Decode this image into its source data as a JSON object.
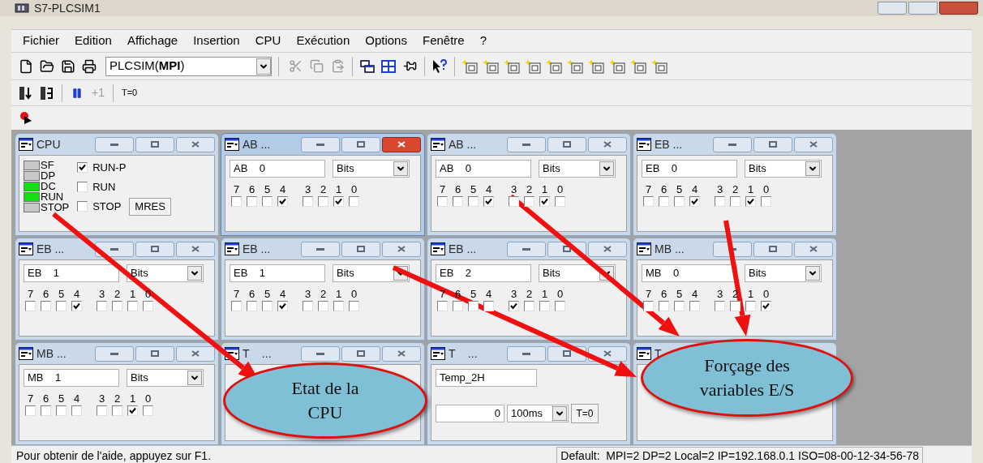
{
  "window": {
    "title": "S7-PLCSIM1"
  },
  "menu": [
    "Fichier",
    "Edition",
    "Affichage",
    "Insertion",
    "CPU",
    "Exécution",
    "Options",
    "Fenêtre",
    "?"
  ],
  "toolbar": {
    "plc_select": "PLCSIM(**MPI**)",
    "step_button": "+1",
    "reset_button": "T=0"
  },
  "panels": [
    {
      "kind": "cpu",
      "title": "CPU",
      "active": false,
      "leds": [
        {
          "label": "SF",
          "on": false
        },
        {
          "label": "DP",
          "on": false
        },
        {
          "label": "DC",
          "on": true
        },
        {
          "label": "RUN",
          "on": true
        },
        {
          "label": "STOP",
          "on": false
        }
      ],
      "modes": [
        {
          "label": "RUN-P",
          "checked": true
        },
        {
          "label": "RUN",
          "checked": false
        },
        {
          "label": "STOP",
          "checked": false
        }
      ],
      "mres_button": "MRES"
    },
    {
      "kind": "byte",
      "title": "AB ...",
      "active": true,
      "address": "AB    0",
      "format": "Bits",
      "bits": [
        {
          "label": "7",
          "checked": false
        },
        {
          "label": "6",
          "checked": false
        },
        {
          "label": "5",
          "checked": false
        },
        {
          "label": "4",
          "checked": true
        },
        {
          "label": "3",
          "checked": false
        },
        {
          "label": "2",
          "checked": false
        },
        {
          "label": "1",
          "checked": true
        },
        {
          "label": "0",
          "checked": false
        }
      ]
    },
    {
      "kind": "byte",
      "title": "AB ...",
      "active": false,
      "address": "AB    0",
      "format": "Bits",
      "bits": [
        {
          "label": "7",
          "checked": false
        },
        {
          "label": "6",
          "checked": false
        },
        {
          "label": "5",
          "checked": false
        },
        {
          "label": "4",
          "checked": true
        },
        {
          "label": "3",
          "checked": false
        },
        {
          "label": "2",
          "checked": false
        },
        {
          "label": "1",
          "checked": true
        },
        {
          "label": "0",
          "checked": false
        }
      ]
    },
    {
      "kind": "byte",
      "title": "EB ...",
      "active": false,
      "address": "EB    0",
      "format": "Bits",
      "bits": [
        {
          "label": "7",
          "checked": false
        },
        {
          "label": "6",
          "checked": false
        },
        {
          "label": "5",
          "checked": false
        },
        {
          "label": "4",
          "checked": true
        },
        {
          "label": "3",
          "checked": false
        },
        {
          "label": "2",
          "checked": false
        },
        {
          "label": "1",
          "checked": true
        },
        {
          "label": "0",
          "checked": false
        }
      ]
    },
    {
      "kind": "byte",
      "title": "EB ...",
      "active": false,
      "address": "EB    1",
      "format": "Bits",
      "bits": [
        {
          "label": "7",
          "checked": false
        },
        {
          "label": "6",
          "checked": false
        },
        {
          "label": "5",
          "checked": false
        },
        {
          "label": "4",
          "checked": true
        },
        {
          "label": "3",
          "checked": false
        },
        {
          "label": "2",
          "checked": false
        },
        {
          "label": "1",
          "checked": false
        },
        {
          "label": "0",
          "checked": false
        }
      ]
    },
    {
      "kind": "byte",
      "title": "EB ...",
      "active": false,
      "address": "EB    1",
      "format": "Bits",
      "bits": [
        {
          "label": "7",
          "checked": false
        },
        {
          "label": "6",
          "checked": false
        },
        {
          "label": "5",
          "checked": false
        },
        {
          "label": "4",
          "checked": true
        },
        {
          "label": "3",
          "checked": false
        },
        {
          "label": "2",
          "checked": false
        },
        {
          "label": "1",
          "checked": false
        },
        {
          "label": "0",
          "checked": false
        }
      ]
    },
    {
      "kind": "byte",
      "title": "EB ...",
      "active": false,
      "address": "EB    2",
      "format": "Bits",
      "bits": [
        {
          "label": "7",
          "checked": false
        },
        {
          "label": "6",
          "checked": false
        },
        {
          "label": "5",
          "checked": false
        },
        {
          "label": "4",
          "checked": false
        },
        {
          "label": "3",
          "checked": true
        },
        {
          "label": "2",
          "checked": false
        },
        {
          "label": "1",
          "checked": false
        },
        {
          "label": "0",
          "checked": false
        }
      ]
    },
    {
      "kind": "byte",
      "title": "MB ...",
      "active": false,
      "address": "MB    0",
      "format": "Bits",
      "bits": [
        {
          "label": "7",
          "checked": false
        },
        {
          "label": "6",
          "checked": false
        },
        {
          "label": "5",
          "checked": false
        },
        {
          "label": "4",
          "checked": false
        },
        {
          "label": "3",
          "checked": false
        },
        {
          "label": "2",
          "checked": false
        },
        {
          "label": "1",
          "checked": false
        },
        {
          "label": "0",
          "checked": true
        }
      ]
    },
    {
      "kind": "byte",
      "title": "MB ...",
      "active": false,
      "address": "MB    1",
      "format": "Bits",
      "bits": [
        {
          "label": "7",
          "checked": false
        },
        {
          "label": "6",
          "checked": false
        },
        {
          "label": "5",
          "checked": false
        },
        {
          "label": "4",
          "checked": false
        },
        {
          "label": "3",
          "checked": false
        },
        {
          "label": "2",
          "checked": false
        },
        {
          "label": "1",
          "checked": true
        },
        {
          "label": "0",
          "checked": false
        }
      ]
    },
    {
      "kind": "timer",
      "title": "T    ...",
      "active": false
    },
    {
      "kind": "timer",
      "title": "T    ...",
      "active": false,
      "name": "Temp_2H",
      "value": "0",
      "base": "100ms",
      "reset_button": "T=0"
    },
    {
      "kind": "timer",
      "title": "T",
      "active": false,
      "buttons_hidden": true
    }
  ],
  "callouts": [
    {
      "text": "Etat de la\nCPU"
    },
    {
      "text": "Forçage des\nvariables E/S"
    }
  ],
  "status_bar": {
    "help": "Pour obtenir de l'aide, appuyez sur F1.",
    "connection": "Default:  MPI=2 DP=2 Local=2 IP=192.168.0.1 ISO=08-00-12-34-56-78"
  }
}
